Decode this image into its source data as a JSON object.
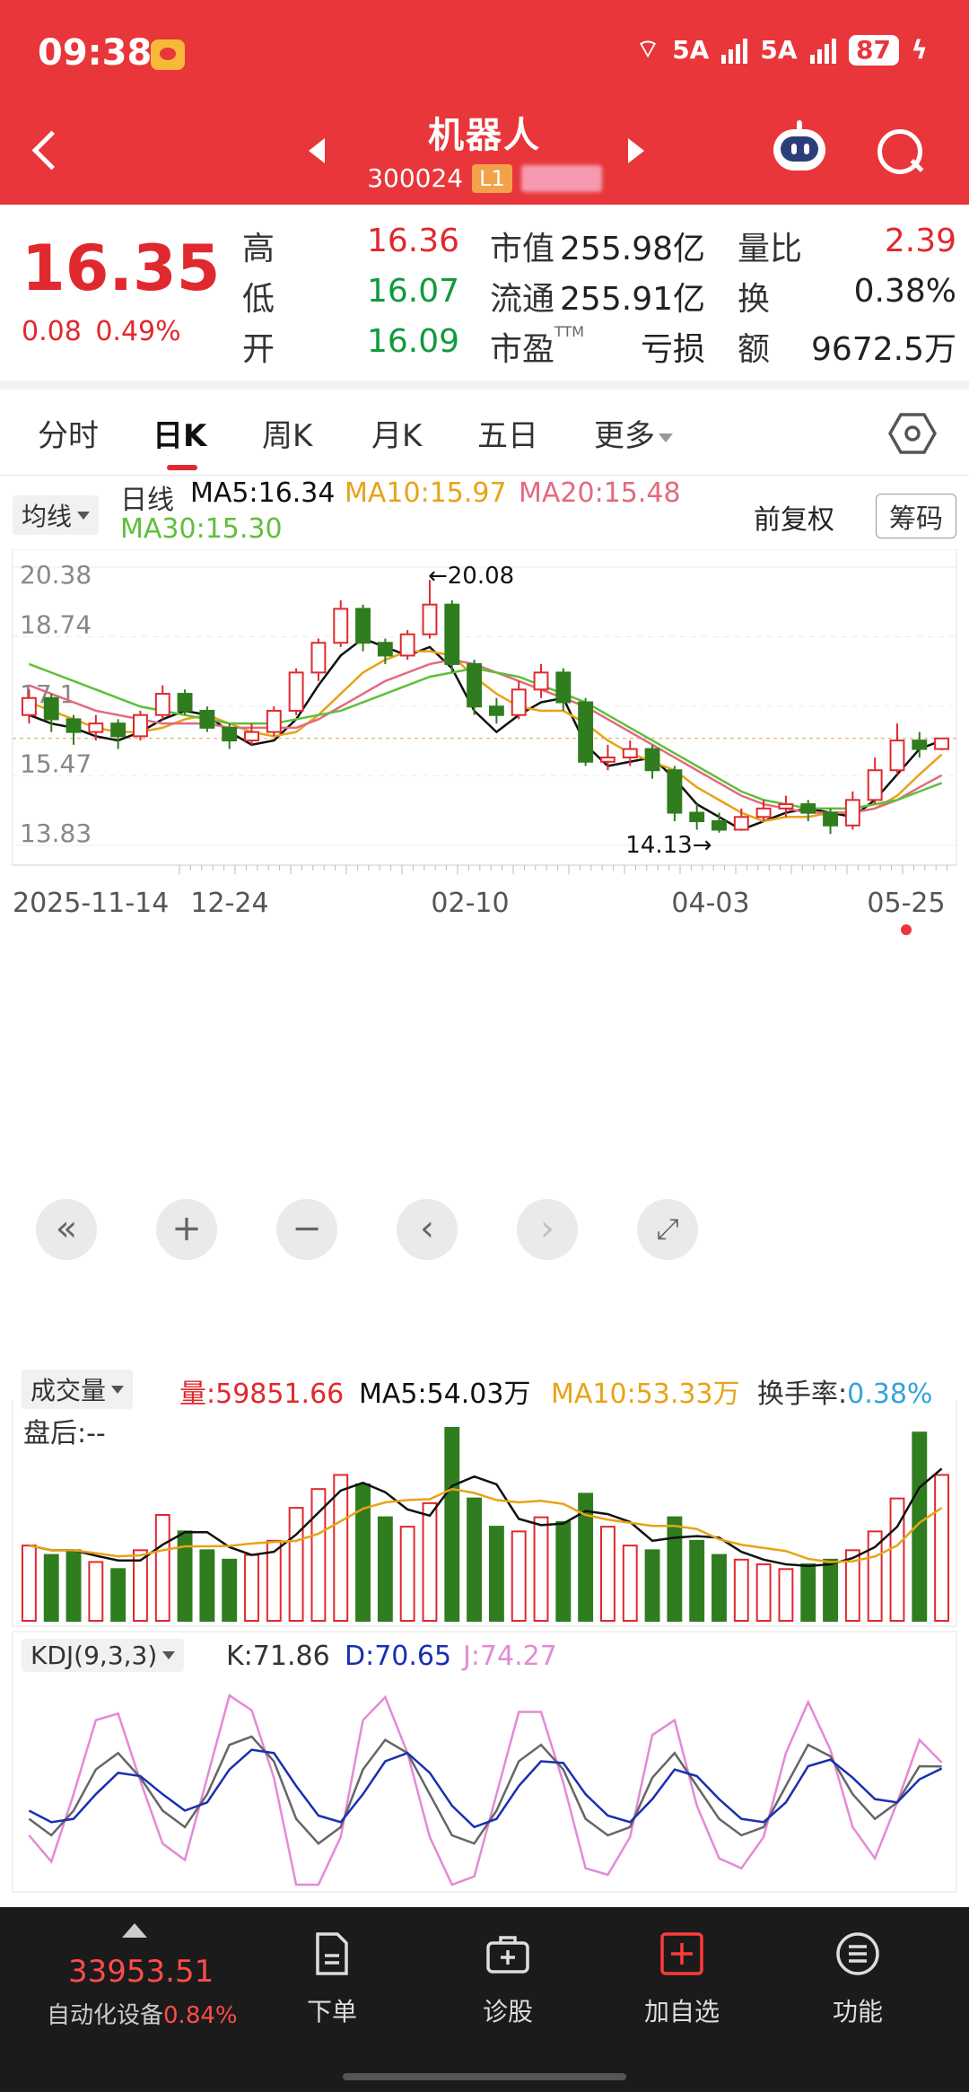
{
  "status": {
    "time": "09:38",
    "net1": "5A",
    "net2": "5A",
    "battery": "87"
  },
  "header": {
    "title": "机器人",
    "code": "300024",
    "level": "L1"
  },
  "quote": {
    "price": "16.35",
    "change": "0.08",
    "change_pct": "0.49%",
    "labels": {
      "high": "高",
      "low": "低",
      "open": "开",
      "mktcap": "市值",
      "float": "流通",
      "pe": "市盈",
      "ttm": "TTM",
      "volratio": "量比",
      "turnover": "换",
      "amount": "额"
    },
    "values": {
      "high": "16.36",
      "low": "16.07",
      "open": "16.09",
      "mktcap": "255.98亿",
      "float": "255.91亿",
      "pe": "亏损",
      "volratio": "2.39",
      "turnover": "0.38%",
      "amount": "9672.5万"
    }
  },
  "tabs": [
    "分时",
    "日K",
    "周K",
    "月K",
    "五日",
    "更多"
  ],
  "ma": {
    "dropdown": "均线",
    "period": "日线",
    "ma5": "MA5:16.34",
    "ma10": "MA10:15.97",
    "ma20": "MA20:15.48",
    "ma30": "MA30:15.30",
    "adjust": "前复权",
    "chips": "筹码"
  },
  "colors": {
    "up": "#e0292e",
    "down": "#2f7d1f",
    "ma5": "#111111",
    "ma10": "#e8a317",
    "ma20": "#e36a80",
    "ma30": "#5fbf3a"
  },
  "chart_data": {
    "type": "candlestick",
    "y_ticks": [
      "20.38",
      "18.74",
      "17.1",
      "15.47",
      "13.83"
    ],
    "ylim": [
      13.83,
      20.38
    ],
    "x_labels": [
      "2025-11-14",
      "12-24",
      "02-10",
      "04-03",
      "05-25"
    ],
    "annotations": {
      "max": "20.08",
      "min": "14.13"
    },
    "series": [
      {
        "name": "MA5",
        "values": [
          16.9,
          16.7,
          16.6,
          16.4,
          16.3,
          16.5,
          16.8,
          17.0,
          16.9,
          16.5,
          16.2,
          16.3,
          16.8,
          17.6,
          18.3,
          18.7,
          18.5,
          18.3,
          18.5,
          18.0,
          17.0,
          16.5,
          16.9,
          17.2,
          17.3,
          16.2,
          15.7,
          15.8,
          15.9,
          15.4,
          14.8,
          14.5,
          14.2,
          14.4,
          14.6,
          14.7,
          14.6,
          14.5,
          14.9,
          15.5,
          16.1,
          16.3
        ]
      },
      {
        "name": "MA10",
        "values": [
          17.2,
          17.0,
          16.8,
          16.6,
          16.5,
          16.5,
          16.6,
          16.8,
          16.9,
          16.7,
          16.5,
          16.4,
          16.5,
          16.9,
          17.4,
          17.9,
          18.2,
          18.4,
          18.4,
          18.3,
          17.8,
          17.4,
          17.1,
          17.0,
          17.0,
          16.7,
          16.3,
          16.0,
          15.8,
          15.6,
          15.2,
          14.9,
          14.6,
          14.4,
          14.5,
          14.5,
          14.6,
          14.6,
          14.7,
          15.0,
          15.5,
          15.97
        ]
      },
      {
        "name": "MA20",
        "values": [
          17.6,
          17.4,
          17.2,
          17.0,
          16.9,
          16.8,
          16.7,
          16.7,
          16.7,
          16.6,
          16.6,
          16.6,
          16.6,
          16.8,
          17.1,
          17.4,
          17.7,
          17.9,
          18.1,
          18.2,
          18.1,
          17.9,
          17.7,
          17.5,
          17.3,
          17.1,
          16.8,
          16.5,
          16.2,
          15.9,
          15.6,
          15.3,
          15.0,
          14.8,
          14.7,
          14.6,
          14.6,
          14.6,
          14.7,
          14.9,
          15.2,
          15.48
        ]
      },
      {
        "name": "MA30",
        "values": [
          18.1,
          17.9,
          17.7,
          17.5,
          17.3,
          17.1,
          17.0,
          16.9,
          16.8,
          16.7,
          16.7,
          16.7,
          16.8,
          16.9,
          17.0,
          17.2,
          17.4,
          17.6,
          17.8,
          17.9,
          18.0,
          17.9,
          17.8,
          17.6,
          17.4,
          17.2,
          16.9,
          16.6,
          16.3,
          16.0,
          15.7,
          15.4,
          15.1,
          14.9,
          14.8,
          14.7,
          14.7,
          14.7,
          14.8,
          14.9,
          15.1,
          15.3
        ]
      }
    ],
    "candles": [
      [
        16.9,
        17.3,
        17.5,
        16.7
      ],
      [
        17.3,
        16.8,
        17.4,
        16.5
      ],
      [
        16.8,
        16.5,
        16.9,
        16.2
      ],
      [
        16.5,
        16.7,
        16.9,
        16.3
      ],
      [
        16.7,
        16.4,
        16.8,
        16.1
      ],
      [
        16.4,
        16.9,
        17.0,
        16.3
      ],
      [
        16.9,
        17.4,
        17.6,
        16.8
      ],
      [
        17.4,
        17.0,
        17.5,
        16.9
      ],
      [
        17.0,
        16.6,
        17.1,
        16.5
      ],
      [
        16.6,
        16.3,
        16.7,
        16.1
      ],
      [
        16.3,
        16.5,
        16.7,
        16.2
      ],
      [
        16.5,
        17.0,
        17.1,
        16.4
      ],
      [
        17.0,
        17.9,
        18.0,
        16.9
      ],
      [
        17.9,
        18.6,
        18.7,
        17.7
      ],
      [
        18.6,
        19.4,
        19.6,
        18.5
      ],
      [
        19.4,
        18.6,
        19.5,
        18.4
      ],
      [
        18.6,
        18.3,
        18.7,
        18.1
      ],
      [
        18.3,
        18.8,
        18.9,
        18.2
      ],
      [
        18.8,
        19.5,
        20.08,
        18.7
      ],
      [
        19.5,
        18.1,
        19.6,
        17.9
      ],
      [
        18.1,
        17.1,
        18.2,
        16.9
      ],
      [
        17.1,
        16.9,
        17.3,
        16.7
      ],
      [
        16.9,
        17.5,
        17.7,
        16.8
      ],
      [
        17.5,
        17.9,
        18.1,
        17.3
      ],
      [
        17.9,
        17.2,
        18.0,
        17.0
      ],
      [
        17.2,
        15.8,
        17.3,
        15.7
      ],
      [
        15.8,
        15.9,
        16.2,
        15.6
      ],
      [
        15.9,
        16.1,
        16.3,
        15.7
      ],
      [
        16.1,
        15.6,
        16.2,
        15.4
      ],
      [
        15.6,
        14.6,
        15.7,
        14.4
      ],
      [
        14.6,
        14.4,
        14.8,
        14.2
      ],
      [
        14.4,
        14.2,
        14.6,
        14.13
      ],
      [
        14.2,
        14.5,
        14.7,
        14.2
      ],
      [
        14.5,
        14.7,
        14.9,
        14.4
      ],
      [
        14.7,
        14.8,
        15.0,
        14.5
      ],
      [
        14.8,
        14.6,
        14.9,
        14.4
      ],
      [
        14.6,
        14.3,
        14.7,
        14.1
      ],
      [
        14.3,
        14.9,
        15.1,
        14.2
      ],
      [
        14.9,
        15.6,
        15.9,
        14.8
      ],
      [
        15.6,
        16.3,
        16.7,
        15.5
      ],
      [
        16.3,
        16.1,
        16.5,
        15.9
      ],
      [
        16.1,
        16.35,
        16.36,
        16.07
      ]
    ]
  },
  "volume": {
    "dropdown": "成交量",
    "vol": "量:59851.66",
    "ma5": "MA5:54.03万",
    "ma10": "MA10:53.33万",
    "turnover_label": "换手率:",
    "turnover": "0.38%",
    "after": "盘后:--",
    "values": [
      32,
      28,
      30,
      25,
      22,
      30,
      45,
      38,
      30,
      26,
      28,
      34,
      48,
      56,
      62,
      58,
      44,
      40,
      50,
      82,
      52,
      40,
      38,
      44,
      42,
      54,
      40,
      32,
      30,
      44,
      34,
      28,
      26,
      24,
      22,
      24,
      26,
      30,
      38,
      52,
      80,
      62
    ]
  },
  "kdj": {
    "dropdown": "KDJ(9,3,3)",
    "k": "K:71.86",
    "d": "D:70.65",
    "j": "J:74.27",
    "kv": [
      40,
      30,
      45,
      70,
      80,
      65,
      45,
      35,
      55,
      85,
      90,
      75,
      40,
      25,
      35,
      70,
      88,
      80,
      55,
      30,
      25,
      45,
      75,
      85,
      70,
      40,
      30,
      35,
      65,
      80,
      60,
      40,
      30,
      35,
      60,
      85,
      78,
      55,
      40,
      50,
      72,
      71.86
    ],
    "dv": [
      45,
      38,
      40,
      55,
      68,
      66,
      55,
      45,
      50,
      70,
      82,
      80,
      60,
      42,
      38,
      55,
      75,
      80,
      68,
      48,
      35,
      40,
      60,
      75,
      74,
      55,
      42,
      38,
      52,
      70,
      66,
      52,
      40,
      38,
      50,
      72,
      76,
      65,
      52,
      50,
      64,
      70.65
    ],
    "jv": [
      30,
      14,
      55,
      100,
      104,
      63,
      25,
      15,
      65,
      115,
      106,
      65,
      0,
      0,
      29,
      100,
      114,
      80,
      29,
      0,
      5,
      55,
      105,
      105,
      62,
      10,
      6,
      29,
      91,
      100,
      48,
      16,
      10,
      29,
      80,
      111,
      82,
      35,
      16,
      50,
      88,
      74.27
    ]
  },
  "bottom": {
    "index_value": "33953.51",
    "index_name": "自动化设备",
    "index_pct": "0.84%",
    "nav": [
      "下单",
      "诊股",
      "加自选",
      "功能"
    ]
  }
}
